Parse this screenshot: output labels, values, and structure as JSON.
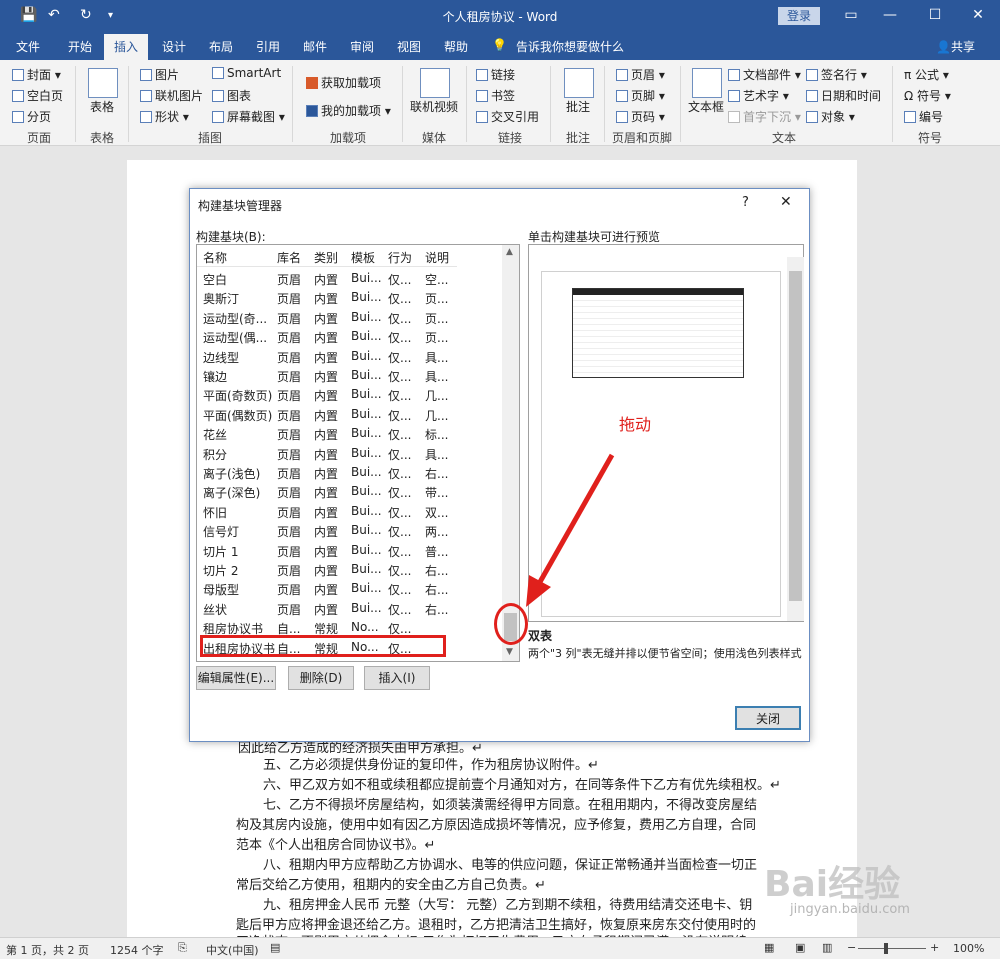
{
  "app": {
    "title": "个人租房协议 - Word",
    "login": "登录",
    "share": "共享"
  },
  "tabs": [
    "文件",
    "开始",
    "插入",
    "设计",
    "布局",
    "引用",
    "邮件",
    "审阅",
    "视图",
    "帮助"
  ],
  "tell_me": "告诉我你想要做什么",
  "ribbon": {
    "pages": [
      "封面",
      "空白页",
      "分页"
    ],
    "table": "表格",
    "illus": [
      "图片",
      "联机图片",
      "形状",
      "SmartArt",
      "图表",
      "屏幕截图"
    ],
    "addins": [
      "获取加载项",
      "我的加载项"
    ],
    "media": "联机视频",
    "links": [
      "链接",
      "书签",
      "交叉引用"
    ],
    "comment": "批注",
    "hf": [
      "页眉",
      "页脚",
      "页码"
    ],
    "text": [
      "文本框",
      "文档部件",
      "艺术字",
      "首字下沉",
      "签名行",
      "日期和时间",
      "对象"
    ],
    "symbols": [
      "公式",
      "符号",
      "编号"
    ],
    "groups": [
      "页面",
      "表格",
      "插图",
      "加载项",
      "媒体",
      "链接",
      "批注",
      "页眉和页脚",
      "文本",
      "符号"
    ]
  },
  "dialog": {
    "title": "构建基块管理器",
    "help": "?",
    "close_x": "✕",
    "list_label": "构建基块(B):",
    "preview_label": "单击构建基块可进行预览",
    "headers": [
      "名称",
      "库名",
      "类别",
      "模板",
      "行为",
      "说明"
    ],
    "rows": [
      [
        "空白",
        "页眉",
        "内置",
        "Bui...",
        "仅...",
        "空..."
      ],
      [
        "奥斯汀",
        "页眉",
        "内置",
        "Bui...",
        "仅...",
        "页..."
      ],
      [
        "运动型(奇...",
        "页眉",
        "内置",
        "Bui...",
        "仅...",
        "页..."
      ],
      [
        "运动型(偶...",
        "页眉",
        "内置",
        "Bui...",
        "仅...",
        "页..."
      ],
      [
        "边线型",
        "页眉",
        "内置",
        "Bui...",
        "仅...",
        "具..."
      ],
      [
        "镶边",
        "页眉",
        "内置",
        "Bui...",
        "仅...",
        "具..."
      ],
      [
        "平面(奇数页)",
        "页眉",
        "内置",
        "Bui...",
        "仅...",
        "几..."
      ],
      [
        "平面(偶数页)",
        "页眉",
        "内置",
        "Bui...",
        "仅...",
        "几..."
      ],
      [
        "花丝",
        "页眉",
        "内置",
        "Bui...",
        "仅...",
        "标..."
      ],
      [
        "积分",
        "页眉",
        "内置",
        "Bui...",
        "仅...",
        "具..."
      ],
      [
        "离子(浅色)",
        "页眉",
        "内置",
        "Bui...",
        "仅...",
        "右..."
      ],
      [
        "离子(深色)",
        "页眉",
        "内置",
        "Bui...",
        "仅...",
        "带..."
      ],
      [
        "怀旧",
        "页眉",
        "内置",
        "Bui...",
        "仅...",
        "双..."
      ],
      [
        "信号灯",
        "页眉",
        "内置",
        "Bui...",
        "仅...",
        "两..."
      ],
      [
        "切片 1",
        "页眉",
        "内置",
        "Bui...",
        "仅...",
        "普..."
      ],
      [
        "切片 2",
        "页眉",
        "内置",
        "Bui...",
        "仅...",
        "右..."
      ],
      [
        "母版型",
        "页眉",
        "内置",
        "Bui...",
        "仅...",
        "右..."
      ],
      [
        "丝状",
        "页眉",
        "内置",
        "Bui...",
        "仅...",
        "右..."
      ],
      [
        "租房协议书",
        "自...",
        "常规",
        "No...",
        "仅...",
        ""
      ],
      [
        "出租房协议书",
        "自...",
        "常规",
        "No...",
        "仅...",
        ""
      ]
    ],
    "annotation": "拖动",
    "desc_title": "双表",
    "desc": "两个\"3 列\"表无缝并排以便节省空间；使用浅色列表样式",
    "btn_edit": "编辑属性(E)...",
    "btn_delete": "删除(D)",
    "btn_insert": "插入(I)",
    "btn_close": "关闭"
  },
  "doc": {
    "lines": [
      "因此给乙方造成的经济损失由甲方承担。↵",
      "五、乙方必须提供身份证的复印件，作为租房协议附件。↵",
      "六、甲乙双方如不租或续租都应提前壹个月通知对方，在同等条件下乙方有优先续租权。↵",
      "七、乙方不得损坏房屋结构，如须装潢需经得甲方同意。在租用期内，不得改变房屋结",
      "构及其房内设施，使用中如有因乙方原因造成损坏等情况，应予修复，费用乙方自理，合同",
      "范本《个人出租房合同协议书》。↵",
      "八、租期内甲方应帮助乙方协调水、电等的供应问题，保证正常畅通并当面检查一切正",
      "常后交给乙方使用，租期内的安全由乙方自己负责。↵",
      "九、租房押金人民币  元整（大写：  元整）乙方到期不续租，待费用结清交还电卡、钥",
      "匙后甲方应将押金退还给乙方。退租时，乙方把清洁卫生搞好，恢复原来房东交付使用时的",
      "干净状态，否则甲方从押金中扣  元作为打扫卫生费用。乙方在承租期间已满，没有说明续"
    ]
  },
  "status": {
    "page": "第 1 页，共 2 页",
    "words": "1254 个字",
    "lang": "中文(中国)",
    "zoom": "100%"
  },
  "watermark": {
    "brand": "Bai经验",
    "url": "jingyan.baidu.com"
  }
}
